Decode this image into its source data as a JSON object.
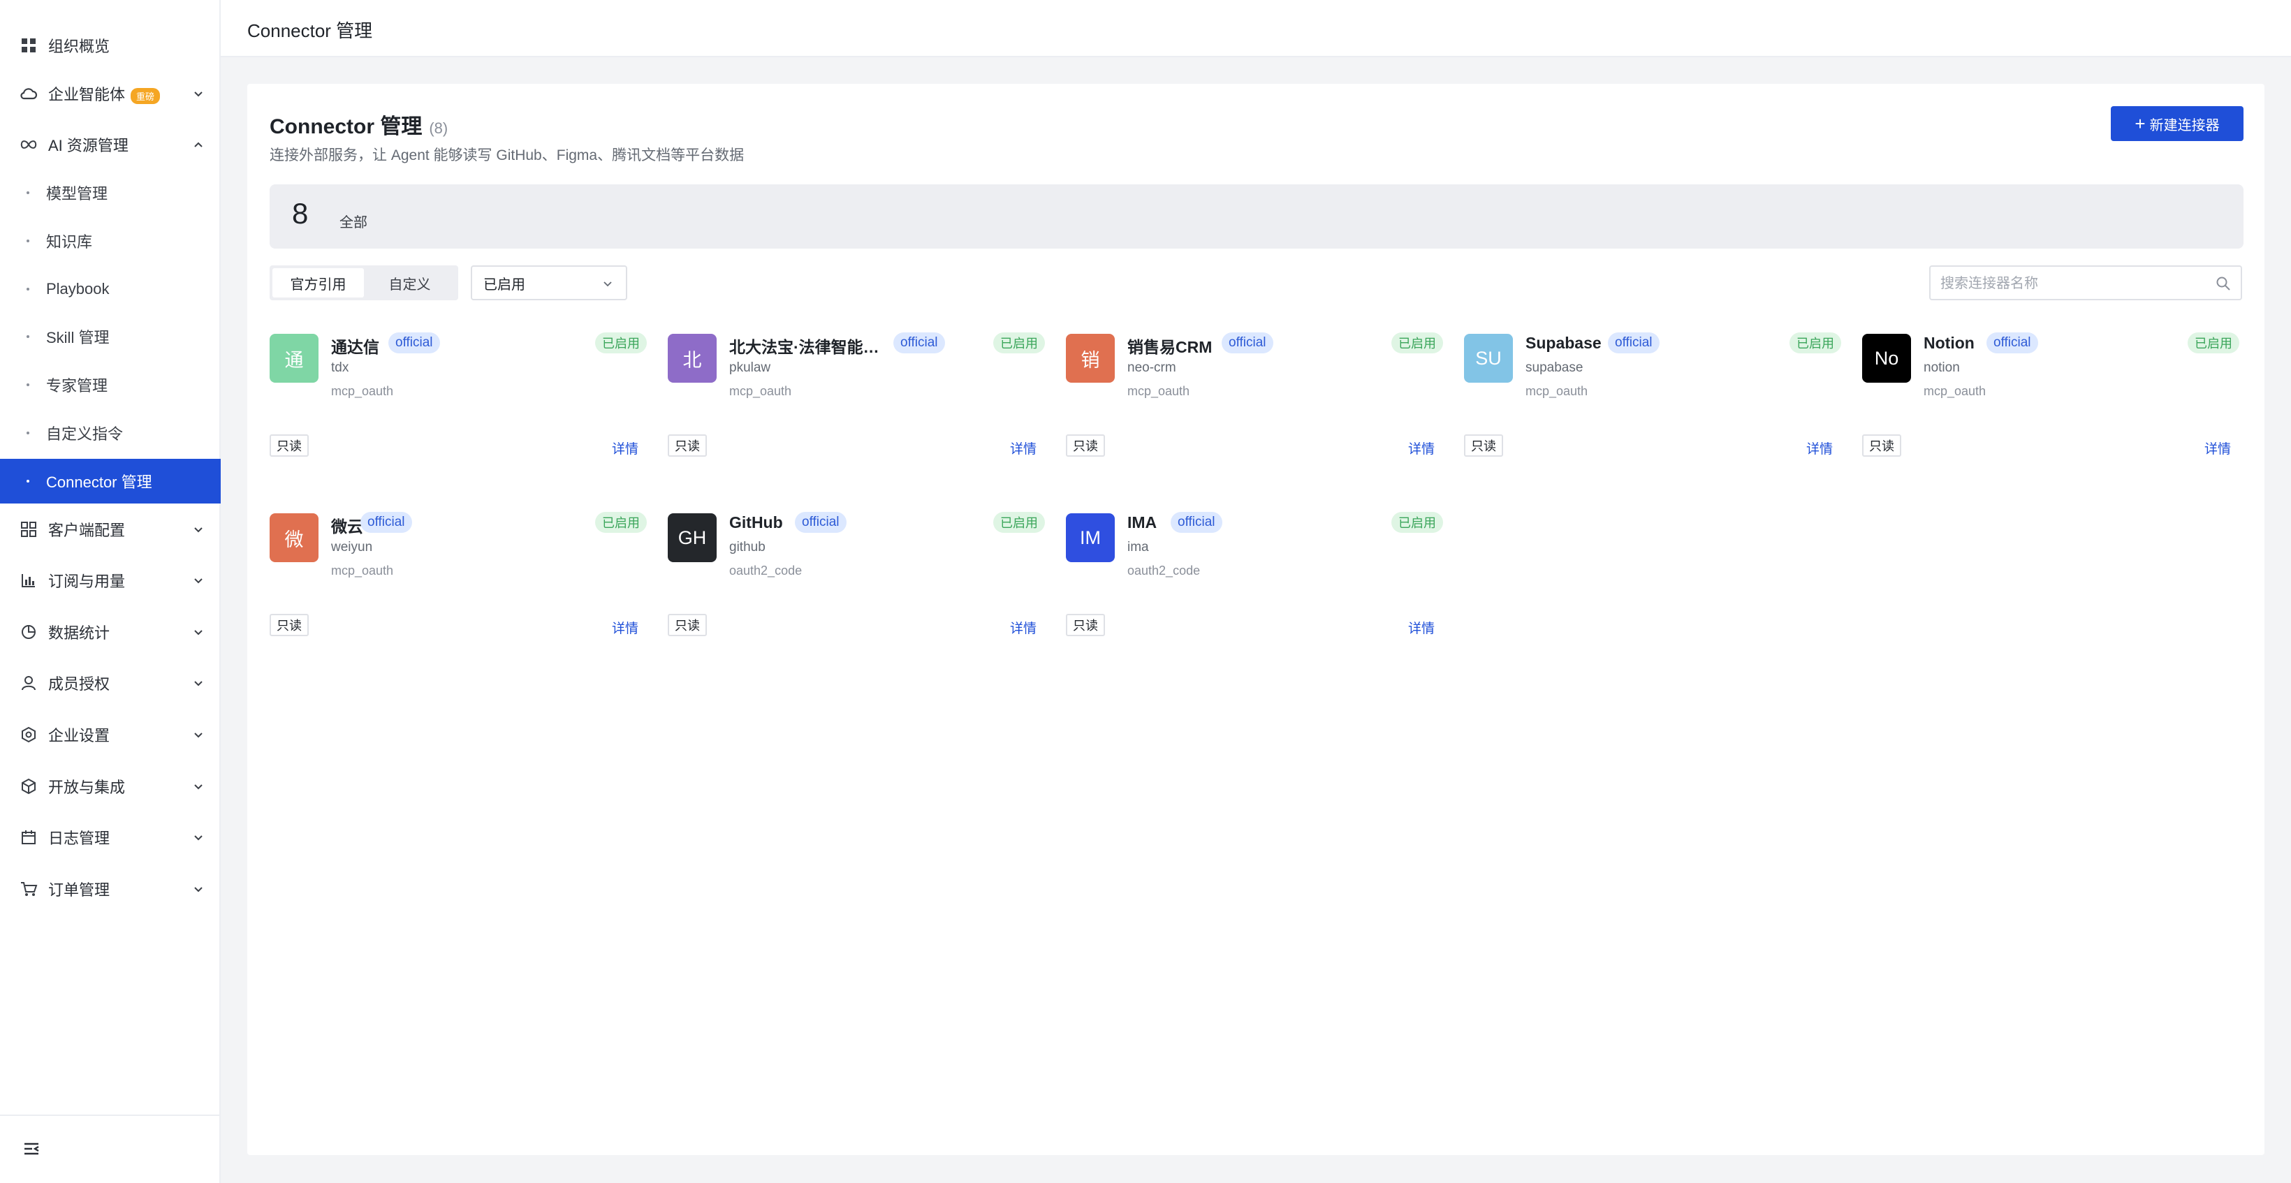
{
  "sidebar": {
    "items": [
      {
        "label": "组织概览",
        "icon": "grid-icon"
      },
      {
        "label": "企业智能体",
        "icon": "cloud-icon",
        "badge": "重磅"
      },
      {
        "label": "AI 资源管理",
        "icon": "infinity-icon"
      },
      {
        "label": "客户端配置",
        "icon": "apps-icon"
      },
      {
        "label": "订阅与用量",
        "icon": "bar-chart-icon"
      },
      {
        "label": "数据统计",
        "icon": "pie-chart-icon"
      },
      {
        "label": "成员授权",
        "icon": "user-icon"
      },
      {
        "label": "企业设置",
        "icon": "settings-icon"
      },
      {
        "label": "开放与集成",
        "icon": "cube-icon"
      },
      {
        "label": "日志管理",
        "icon": "calendar-icon"
      },
      {
        "label": "订单管理",
        "icon": "cart-icon"
      }
    ],
    "sub_items": [
      {
        "label": "模型管理"
      },
      {
        "label": "知识库"
      },
      {
        "label": "Playbook"
      },
      {
        "label": "Skill 管理"
      },
      {
        "label": "专家管理"
      },
      {
        "label": "自定义指令"
      },
      {
        "label": "Connector 管理"
      }
    ]
  },
  "topbar": {
    "title": "Connector 管理"
  },
  "main": {
    "title": "Connector 管理",
    "count": "(8)",
    "subtitle": "连接外部服务，让 Agent 能够读写 GitHub、Figma、腾讯文档等平台数据",
    "new_button": "新建连接器",
    "stat": {
      "value": "8",
      "label": "全部"
    },
    "tabs": [
      {
        "label": "官方引用"
      },
      {
        "label": "自定义"
      }
    ],
    "filter": "已启用",
    "search_placeholder": "搜索连接器名称"
  },
  "connectors": [
    {
      "initial": "通",
      "name": "通达信",
      "slug": "tdx",
      "auth": "mcp_oauth",
      "color": "#7fd6a5",
      "tag": "official",
      "status": "已启用",
      "access": "只读",
      "action": "详情"
    },
    {
      "initial": "北",
      "name": "北大法宝·法律智能…",
      "slug": "pkulaw",
      "auth": "mcp_oauth",
      "color": "#8e6cc8",
      "tag": "official",
      "status": "已启用",
      "access": "只读",
      "action": "详情"
    },
    {
      "initial": "销",
      "name": "销售易CRM",
      "slug": "neo-crm",
      "auth": "mcp_oauth",
      "color": "#e07050",
      "tag": "official",
      "status": "已启用",
      "access": "只读",
      "action": "详情"
    },
    {
      "initial": "SU",
      "name": "Supabase",
      "slug": "supabase",
      "auth": "mcp_oauth",
      "color": "#82c4e6",
      "tag": "official",
      "status": "已启用",
      "access": "只读",
      "action": "详情"
    },
    {
      "initial": "No",
      "name": "Notion",
      "slug": "notion",
      "auth": "mcp_oauth",
      "color": "#000000",
      "tag": "official",
      "status": "已启用",
      "access": "只读",
      "action": "详情"
    },
    {
      "initial": "微",
      "name": "微云",
      "slug": "weiyun",
      "auth": "mcp_oauth",
      "color": "#e07050",
      "tag": "official",
      "status": "已启用",
      "access": "只读",
      "action": "详情"
    },
    {
      "initial": "GH",
      "name": "GitHub",
      "slug": "github",
      "auth": "oauth2_code",
      "color": "#24272b",
      "tag": "official",
      "status": "已启用",
      "access": "只读",
      "action": "详情"
    },
    {
      "initial": "IM",
      "name": "IMA",
      "slug": "ima",
      "auth": "oauth2_code",
      "color": "#2f4fe0",
      "tag": "official",
      "status": "已启用",
      "access": "只读",
      "action": "详情"
    }
  ]
}
